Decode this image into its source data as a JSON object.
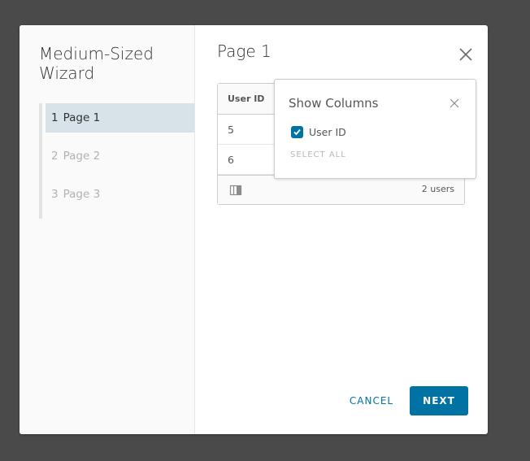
{
  "wizard": {
    "title": "Medium-Sized Wizard",
    "steps": [
      {
        "num": "1",
        "label": "Page 1",
        "active": true
      },
      {
        "num": "2",
        "label": "Page 2",
        "active": false
      },
      {
        "num": "3",
        "label": "Page 3",
        "active": false
      }
    ]
  },
  "page": {
    "title": "Page 1"
  },
  "grid": {
    "columns": [
      "User ID"
    ],
    "rows": [
      {
        "user_id": "5"
      },
      {
        "user_id": "6"
      }
    ],
    "footer_count": "2 users"
  },
  "popover": {
    "title": "Show Columns",
    "columns": [
      {
        "label": "User ID",
        "checked": true
      }
    ],
    "select_all": "SELECT ALL"
  },
  "buttons": {
    "cancel": "CANCEL",
    "next": "NEXT"
  },
  "colors": {
    "primary": "#0072a3",
    "active_step": "#d8e3e9",
    "backdrop": "#4a4a4a"
  }
}
